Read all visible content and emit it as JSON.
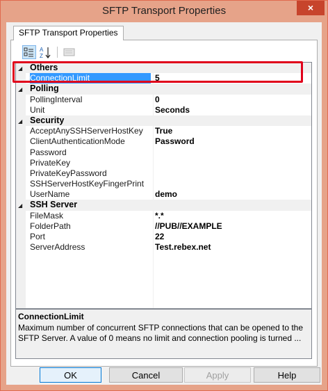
{
  "window": {
    "title": "SFTP Transport Properties",
    "close_glyph": "×"
  },
  "tab": {
    "label": "SFTP Transport Properties"
  },
  "toolbar": {
    "categorized_icon": "categorized-view-icon",
    "alphabetical_icon": "alphabetical-sort-icon",
    "property_pages_icon": "property-pages-icon"
  },
  "grid": {
    "categories": [
      {
        "name": "Others",
        "properties": [
          {
            "name": "ConnectionLimit",
            "value": "5",
            "selected": true
          }
        ]
      },
      {
        "name": "Polling",
        "properties": [
          {
            "name": "PollingInterval",
            "value": "0"
          },
          {
            "name": "Unit",
            "value": "Seconds"
          }
        ]
      },
      {
        "name": "Security",
        "properties": [
          {
            "name": "AcceptAnySSHServerHostKey",
            "value": "True"
          },
          {
            "name": "ClientAuthenticationMode",
            "value": "Password"
          },
          {
            "name": "Password",
            "value": ""
          },
          {
            "name": "PrivateKey",
            "value": ""
          },
          {
            "name": "PrivateKeyPassword",
            "value": ""
          },
          {
            "name": "SSHServerHostKeyFingerPrint",
            "value": ""
          },
          {
            "name": "UserName",
            "value": "demo"
          }
        ]
      },
      {
        "name": "SSH Server",
        "properties": [
          {
            "name": "FileMask",
            "value": "*.*"
          },
          {
            "name": "FolderPath",
            "value": "//PUB//EXAMPLE"
          },
          {
            "name": "Port",
            "value": "22"
          },
          {
            "name": "ServerAddress",
            "value": "Test.rebex.net"
          }
        ]
      }
    ]
  },
  "help": {
    "title": "ConnectionLimit",
    "description": "Maximum number of concurrent SFTP connections that can be opened to the SFTP Server. A value of 0 means no limit and connection pooling is turned ..."
  },
  "buttons": {
    "ok": "OK",
    "cancel": "Cancel",
    "apply": "Apply",
    "help": "Help"
  },
  "colors": {
    "titlebar": "#e6a389",
    "selection": "#3399ff",
    "highlight_box": "#e0001b"
  }
}
